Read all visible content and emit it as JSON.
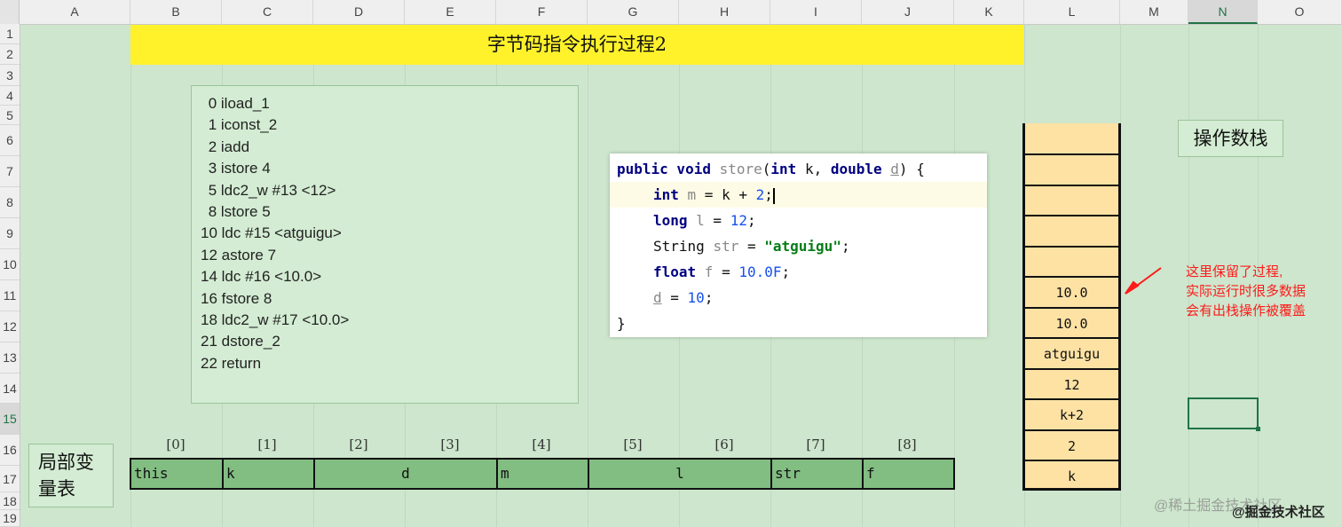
{
  "columns": [
    "A",
    "B",
    "C",
    "D",
    "E",
    "F",
    "G",
    "H",
    "I",
    "J",
    "K",
    "L",
    "M",
    "N",
    "O"
  ],
  "rows": [
    "1",
    "2",
    "3",
    "4",
    "5",
    "6",
    "7",
    "8",
    "9",
    "10",
    "11",
    "12",
    "13",
    "14",
    "15",
    "16",
    "17",
    "18",
    "19"
  ],
  "selected_column": "N",
  "selected_row": "15",
  "title": "字节码指令执行过程2",
  "bytecode": [
    " 0 iload_1",
    " 1 iconst_2",
    " 2 iadd",
    " 3 istore 4",
    " 5 ldc2_w #13 <12>",
    " 8 lstore 5",
    "10 ldc #15 <atguigu>",
    "12 astore 7",
    "14 ldc #16 <10.0>",
    "16 fstore 8",
    "18 ldc2_w #17 <10.0>",
    "21 dstore_2",
    "22 return"
  ],
  "code": {
    "l1": {
      "a": "public void ",
      "b": "store",
      "c": "(",
      "d": "int",
      "e": " k, ",
      "f": "double",
      "g": " ",
      "h": "d",
      "i": ") {"
    },
    "l2": {
      "a": "int",
      "b": " m",
      "c": " = k + ",
      "d": "2",
      "e": ";"
    },
    "l3": {
      "a": "long",
      "b": " l",
      "c": " = ",
      "d": "12",
      "e": ";"
    },
    "l4": {
      "a": "String ",
      "b": "str",
      "c": " = ",
      "d": "\"atguigu\"",
      "e": ";"
    },
    "l5": {
      "a": "float",
      "b": " f",
      "c": " = ",
      "d": "10.0F",
      "e": ";"
    },
    "l6": {
      "a": "d",
      "b": " = ",
      "c": "10",
      "d": ";"
    },
    "l7": "}"
  },
  "operand_stack": {
    "label": "操作数栈",
    "cells": [
      "",
      "",
      "",
      "",
      "",
      "10.0",
      "10.0",
      "atguigu",
      "12",
      "k+2",
      "2",
      "k"
    ]
  },
  "annotation": [
    "这里保留了过程,",
    "实际运行时很多数据",
    "会有出栈操作被覆盖"
  ],
  "local_vars": {
    "label_line1": "局部变",
    "label_line2": "量表",
    "indices": [
      "[0]",
      "[1]",
      "[2]",
      "[3]",
      "[4]",
      "[5]",
      "[6]",
      "[7]",
      "[8]"
    ],
    "slots": [
      "this",
      "k",
      "d",
      "m",
      "l",
      "str",
      "f"
    ]
  },
  "watermark": "@稀土掘金技术社区",
  "watermark2": "@掘金技术社区",
  "colors": {
    "title_bg": "#fff22b",
    "stack_bg": "#fde2a4",
    "lv_bg": "#82bd82",
    "sheet_bg": "#cde6cd",
    "annotation": "#ff1a1a"
  }
}
